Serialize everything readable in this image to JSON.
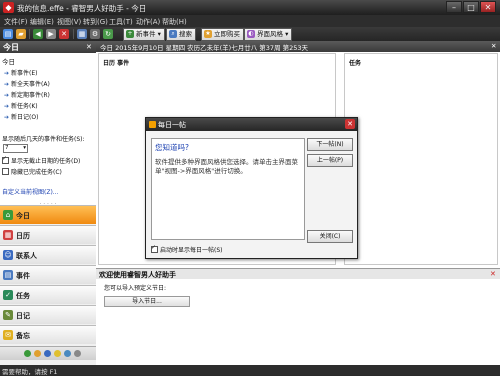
{
  "window": {
    "title": "我的信息.effe - 睿智男人好助手 - 今日"
  },
  "menu": [
    "文件(F)",
    "编辑(E)",
    "视图(V)",
    "转到(G)",
    "工具(T)",
    "动作(A)",
    "帮助(H)"
  ],
  "toolbar": {
    "new_event": "新事件",
    "search": "搜索",
    "print_now": "立即购买",
    "skin": "界面风格"
  },
  "sidebar": {
    "title": "今日",
    "panel_title": "今日",
    "links": [
      "新事件(E)",
      "新全天事件(A)",
      "新定期事件(R)",
      "新任务(K)",
      "新日记(O)"
    ],
    "show_days_label": "显示随后几天的事件和任务(S):",
    "days_value": "7",
    "show_unexpired": "显示无截止日期的任务(D)",
    "hide_completed": "隐藏已完成任务(C)",
    "customize_link": "自定义当前视图(Z)...",
    "nav": [
      "今日",
      "日历",
      "联系人",
      "事件",
      "任务",
      "日记",
      "备忘"
    ]
  },
  "main": {
    "date_line": "今日  2015年9月10日  星期四  农历乙未年(羊)七月廿八  第37周  第253天",
    "col_event_date": "日历",
    "col_event": "事件",
    "col_task": "任务",
    "lower_title": "欢迎使用睿智男人好助手",
    "lower_text": "您可以导入预定义节日:",
    "import_button": "导入节日..."
  },
  "dialog": {
    "title": "每日一帖",
    "question": "您知道吗?",
    "tip": "软件提供多种界面风格供您选择。请单击主界面菜单\"视图->界面风格\"进行切换。",
    "next": "下一帖(N)",
    "prev": "上一帖(P)",
    "close": "关闭(C)",
    "startup": "启动时显示每日一帖(S)"
  },
  "status": {
    "text": "需要帮助，请按 F1"
  }
}
